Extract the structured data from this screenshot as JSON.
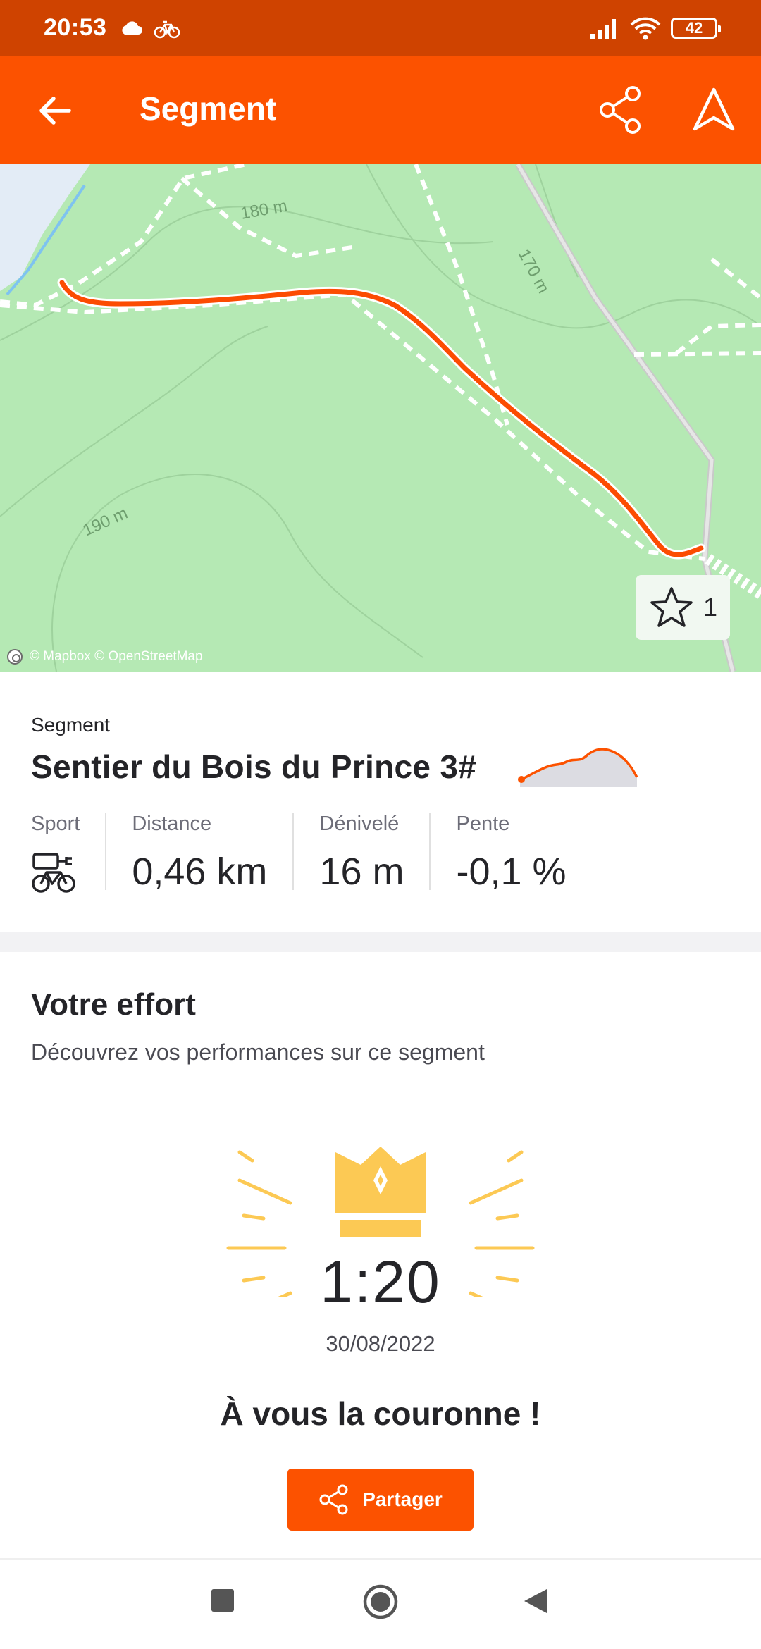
{
  "status_bar": {
    "time": "20:53",
    "battery": "42",
    "icons": [
      "cloud-icon",
      "bike-icon",
      "signal-icon",
      "wifi-icon",
      "battery-icon"
    ]
  },
  "app_bar": {
    "title": "Segment",
    "icons": [
      "back-arrow-icon",
      "share-icon",
      "navigate-icon"
    ]
  },
  "map": {
    "contour_labels": [
      "180 m",
      "170 m",
      "190 m"
    ],
    "attribution": "© Mapbox © OpenStreetMap",
    "star_count": "1"
  },
  "segment": {
    "label": "Segment",
    "name": "Sentier du Bois du Prince 3#",
    "stats": [
      {
        "label": "Sport",
        "value": ""
      },
      {
        "label": "Distance",
        "value": "0,46 km"
      },
      {
        "label": "Dénivelé",
        "value": "16 m"
      },
      {
        "label": "Pente",
        "value": "-0,1 %"
      }
    ]
  },
  "effort": {
    "title": "Votre effort",
    "subtitle": "Découvrez vos performances sur ce segment",
    "time": "1:20",
    "date": "30/08/2022",
    "crown_text": "À vous la couronne !",
    "share_label": "Partager"
  },
  "colors": {
    "status_bar": "#CF4300",
    "app_bar": "#FC5200",
    "map_green": "#B5E9B4",
    "route": "#FC4C02",
    "crown": "#FCC954"
  }
}
